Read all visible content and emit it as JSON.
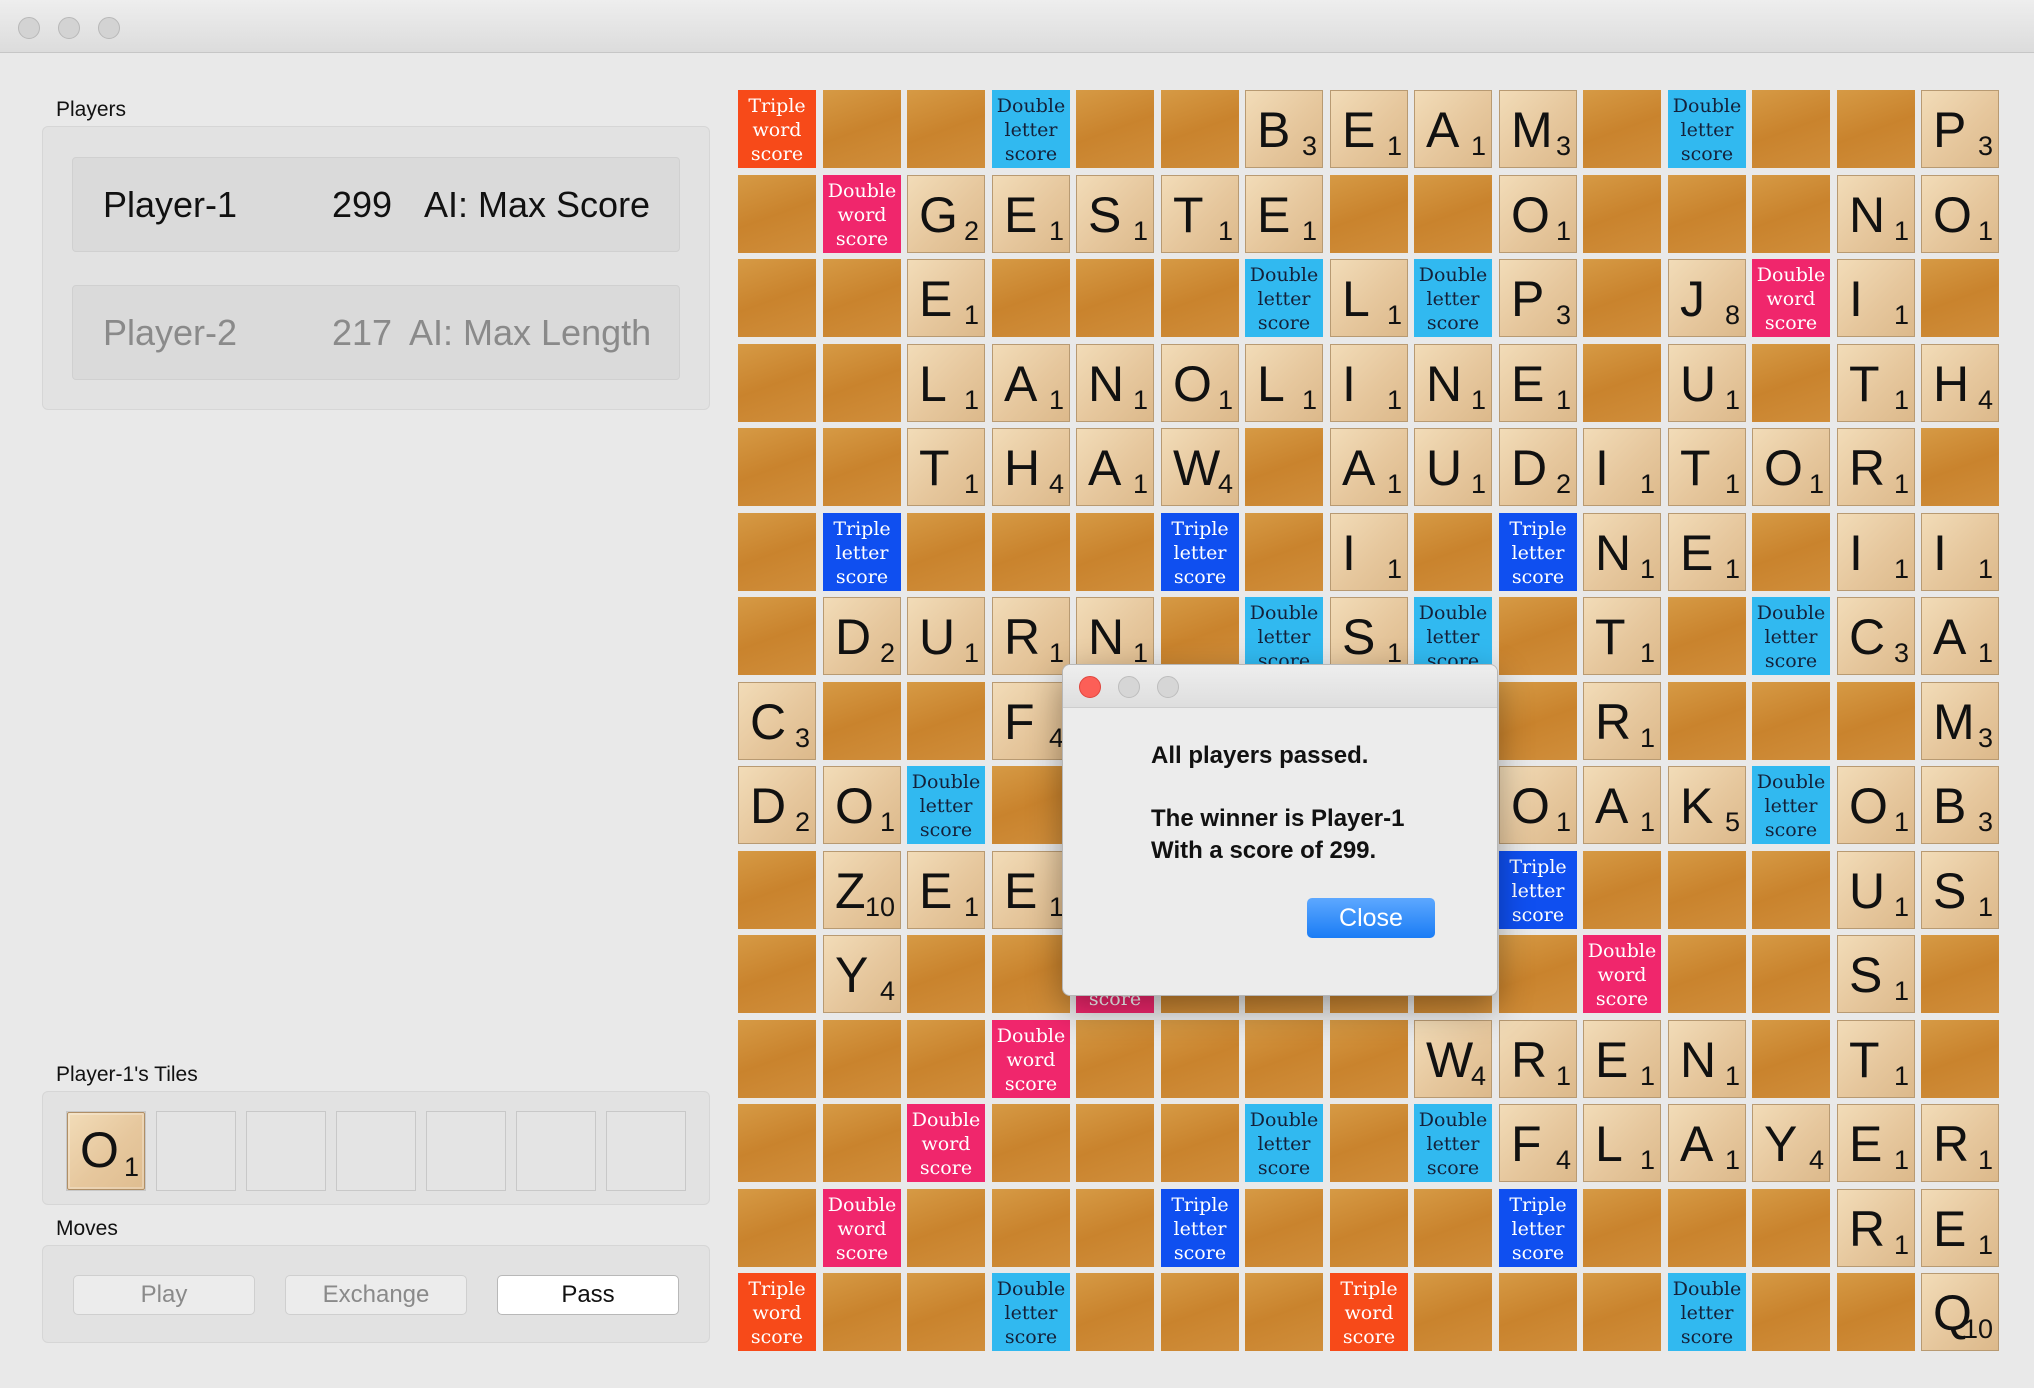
{
  "window": {
    "title": ""
  },
  "players_section": {
    "label": "Players",
    "players": [
      {
        "name": "Player-1",
        "score": "299",
        "strategy": "AI: Max Score",
        "active": true
      },
      {
        "name": "Player-2",
        "score": "217",
        "strategy": "AI: Max Length",
        "active": false
      }
    ]
  },
  "tiles_section": {
    "label": "Player-1's Tiles",
    "tiles": [
      {
        "letter": "O",
        "value": "1"
      }
    ]
  },
  "moves_section": {
    "label": "Moves",
    "play_label": "Play",
    "exchange_label": "Exchange",
    "pass_label": "Pass"
  },
  "dialog": {
    "line1": "All players passed.",
    "line2": "The winner is Player-1",
    "line3": "With a score of 299.",
    "close_label": "Close"
  },
  "premium_labels": {
    "tw": [
      "Triple",
      "word",
      "score"
    ],
    "dw": [
      "Double",
      "word",
      "score"
    ],
    "tl": [
      "Triple",
      "letter",
      "score"
    ],
    "dl": [
      "Double",
      "letter",
      "score"
    ]
  },
  "board": [
    [
      "tw",
      "",
      "",
      "dl",
      "",
      "",
      "B3",
      "E1",
      "A1",
      "M3",
      "",
      "dl",
      "",
      "",
      "P3"
    ],
    [
      "",
      "dw",
      "G2",
      "E1",
      "S1",
      "T1",
      "E1",
      "",
      "",
      "O1",
      "",
      "",
      "",
      "N1",
      "O1"
    ],
    [
      "",
      "",
      "E1",
      "",
      "",
      "",
      "dl",
      "L1",
      "dl",
      "P3",
      "",
      "J8",
      "dw",
      "I1",
      ""
    ],
    [
      "",
      "",
      "L1",
      "A1",
      "N1",
      "O1",
      "L1",
      "I1",
      "N1",
      "E1",
      "",
      "U1",
      "",
      "T1",
      "H4"
    ],
    [
      "",
      "",
      "T1",
      "H4",
      "A1",
      "W4",
      "",
      "A1",
      "U1",
      "D2",
      "I1",
      "T1",
      "O1",
      "R1",
      ""
    ],
    [
      "",
      "tl",
      "",
      "",
      "",
      "tl",
      "",
      "I1",
      "",
      "tl",
      "N1",
      "E1",
      "",
      "I1",
      "I1"
    ],
    [
      "",
      "D2",
      "U1",
      "R1",
      "N1",
      "",
      "dl",
      "S1",
      "dl",
      "",
      "T1",
      "",
      "dl",
      "C3",
      "A1"
    ],
    [
      "C3",
      "",
      "",
      "F4",
      "",
      "",
      "",
      "",
      "",
      "",
      "R1",
      "",
      "",
      "",
      "M3"
    ],
    [
      "D2",
      "O1",
      "dl",
      "",
      "",
      "",
      "",
      "",
      "",
      "O1",
      "A1",
      "K5",
      "dl",
      "O1",
      "B3"
    ],
    [
      "",
      "Z10",
      "E1",
      "E1",
      "",
      "",
      "",
      "",
      "",
      "tl",
      "",
      "",
      "",
      "U1",
      "S1"
    ],
    [
      "",
      "Y4",
      "",
      "",
      "dw",
      "",
      "",
      "",
      "",
      "",
      "dw",
      "",
      "",
      "S1",
      ""
    ],
    [
      "",
      "",
      "",
      "dw",
      "",
      "",
      "",
      "",
      "W4",
      "R1",
      "E1",
      "N1",
      "",
      "T1",
      ""
    ],
    [
      "",
      "",
      "dw",
      "",
      "",
      "",
      "dl",
      "",
      "dl",
      "F4",
      "L1",
      "A1",
      "Y4",
      "E1",
      "R1"
    ],
    [
      "",
      "dw",
      "",
      "",
      "",
      "tl",
      "",
      "",
      "",
      "tl",
      "",
      "",
      "",
      "R1",
      "E1"
    ],
    [
      "tw",
      "",
      "",
      "dl",
      "",
      "",
      "",
      "tw",
      "",
      "",
      "",
      "dl",
      "",
      "",
      "Q10"
    ]
  ]
}
